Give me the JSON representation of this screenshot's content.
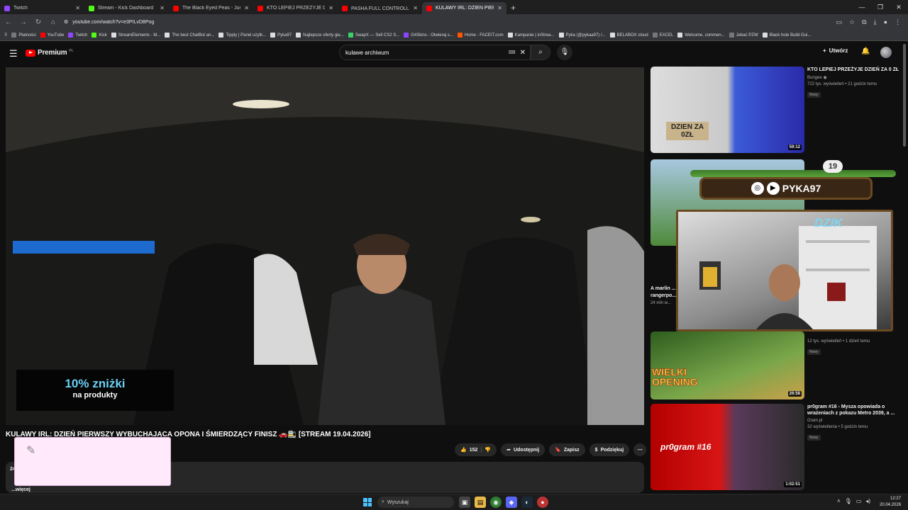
{
  "tabs": [
    {
      "label": "Twitch",
      "color": "#9146ff",
      "active": false
    },
    {
      "label": "Stream - Kick Dashboard",
      "color": "#53fc18",
      "active": false
    },
    {
      "label": "The Black Eyed Peas - Just Can",
      "color": "#ff0000",
      "active": false
    },
    {
      "label": "KTO LEPIEJ PRZEŻYJE DZIEŃ ZA",
      "color": "#ff0000",
      "active": false
    },
    {
      "label": "PASHA FULL CONTROLL 😱 ME",
      "color": "#ff0000",
      "active": false
    },
    {
      "label": "KULAWY IRL: DZIEŃ PIERW",
      "color": "#ff0000",
      "active": true
    }
  ],
  "address": {
    "url": "youtube.com/watch?v=e3PILvD8Pog"
  },
  "bookmarks": [
    {
      "label": "Płatności",
      "color": "#777"
    },
    {
      "label": "YouTube",
      "color": "#ff0000"
    },
    {
      "label": "Twitch",
      "color": "#9146ff"
    },
    {
      "label": "Kick",
      "color": "#53fc18"
    },
    {
      "label": "StreamElements - M...",
      "color": "#ddd"
    },
    {
      "label": "The best ChatBot an...",
      "color": "#ddd"
    },
    {
      "label": "Tipply | Panel użytk...",
      "color": "#ddd"
    },
    {
      "label": "Pyka97",
      "color": "#ddd"
    },
    {
      "label": "Najlepsze oferty gie...",
      "color": "#ddd"
    },
    {
      "label": "SwapX — Sell CS2 S...",
      "color": "#3ad16b"
    },
    {
      "label": "G4Skins - Otwieraj s...",
      "color": "#8a46ff"
    },
    {
      "label": "Home - FACEIT.com",
      "color": "#ff5500"
    },
    {
      "label": "Kampanie | inStrea...",
      "color": "#ddd"
    },
    {
      "label": "Pyka (@pykaa97) /...",
      "color": "#ddd"
    },
    {
      "label": "BELABOX cloud",
      "color": "#ddd"
    },
    {
      "label": "EXCEL",
      "color": "#777"
    },
    {
      "label": "Welcome, commen...",
      "color": "#ddd"
    },
    {
      "label": "Jebać PZW",
      "color": "#777"
    },
    {
      "label": "Black hole Build Gui...",
      "color": "#ddd"
    }
  ],
  "youtube": {
    "logo": "Premium",
    "logo_region": "PL",
    "search_value": "kulawe archiwum",
    "create_label": "Utwórz"
  },
  "promo": {
    "big": "10% zniżki",
    "small": "na produkty"
  },
  "video": {
    "title": "KULAWY IRL: DZIEŃ PIERWSZY WYBUCHAJĄCA OPONA I ŚMIERDZĄCY FINISZ 🚗🚉 [STREAM 19.04.2026]",
    "likes": "152",
    "share": "Udostępnij",
    "save": "Zapisz",
    "thanks": "Podziękuj",
    "desc_count": "24",
    "more": "...więcej"
  },
  "overlay": {
    "handle": "PYKA97",
    "brand": "DZIK",
    "level": "19"
  },
  "sidebar": [
    {
      "title": "KTO LEPIEJ PRZEŻYJE DZIEŃ ZA 0 ZŁ",
      "channel": "Bungee ◉",
      "meta": "722 tys. wyświetleń • 21 godzin temu",
      "badge": "Nowy",
      "duration": "59:12",
      "thumb_text": "DZIEN ZA 0ZŁ"
    },
    {
      "title": "A marlin ... rangerpo...",
      "channel": "",
      "meta": "24 mln w...",
      "badge": "",
      "duration": "",
      "thumb_text": ""
    },
    {
      "title": "",
      "channel": "",
      "meta": "12 tys. wyświetleń • 1 dzień temu",
      "badge": "Nowy",
      "duration": "26:58",
      "thumb_text": "WIELKI OPENING"
    },
    {
      "title": "pr0gram #16 - Mysza opowiada o wrażeniach z pokazu Metro 2039, a ...",
      "channel": "Gram.pl",
      "meta": "32 wyświetlenia • 5 godzin temu",
      "badge": "Nowy",
      "duration": "1:02:51",
      "thumb_text": "pr0gram #16"
    }
  ],
  "taskbar": {
    "search": "Wyszukaj",
    "time": "12:27",
    "date": "20.04.2026"
  }
}
